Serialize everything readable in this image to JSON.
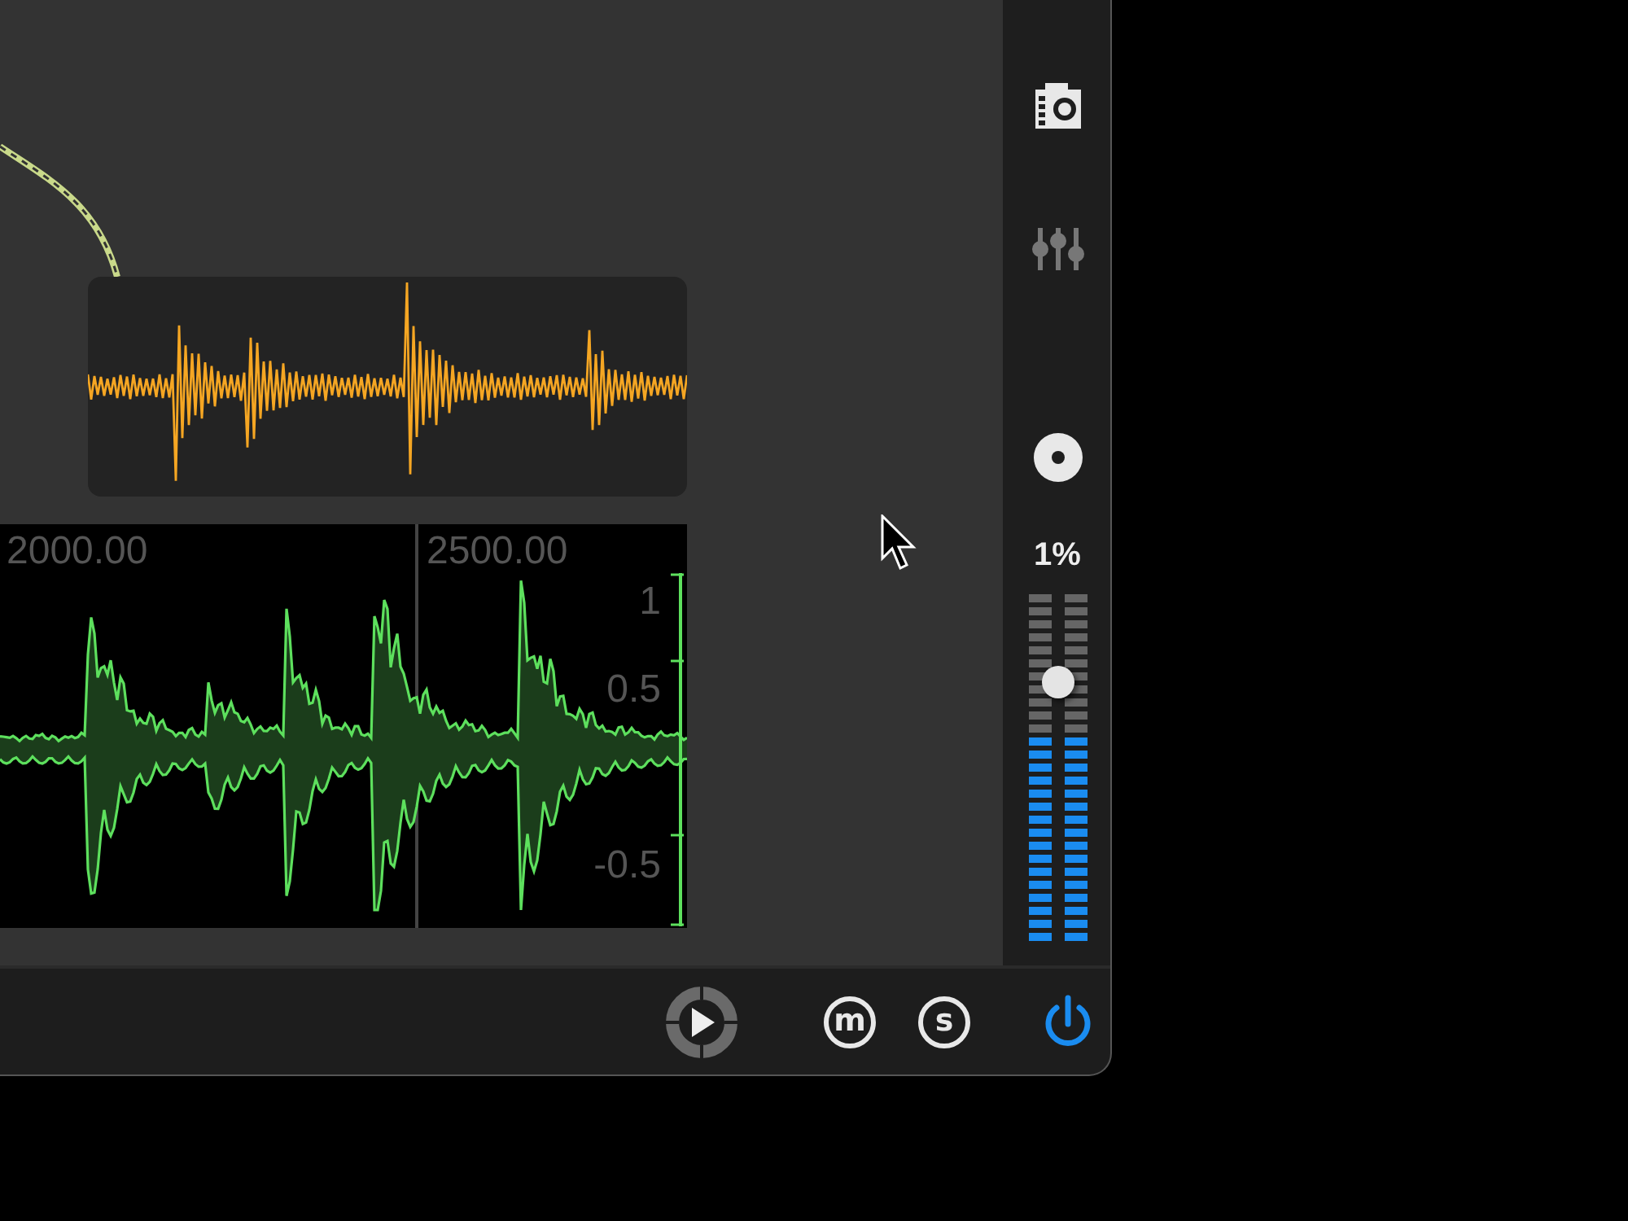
{
  "scope": {
    "x_labels": [
      "2000.00",
      "2500.00"
    ],
    "y_labels": [
      "1",
      "0.5",
      "-0.5"
    ]
  },
  "volume": {
    "reading": "1%",
    "level": 0.75
  },
  "meters": [
    {
      "level": 0.59
    },
    {
      "level": 0.59
    }
  ],
  "transport": {
    "mute_label": "m",
    "solo_label": "s"
  },
  "power": {
    "on": true
  }
}
